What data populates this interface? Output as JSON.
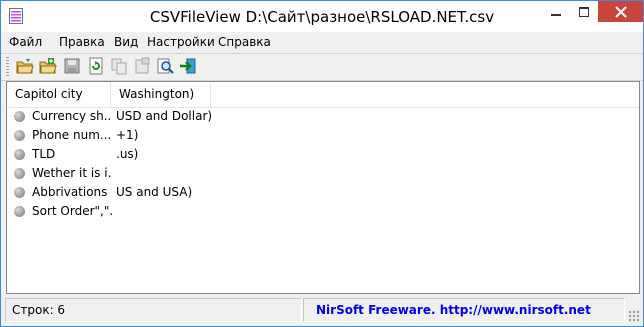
{
  "window": {
    "app_name": "CSVFileView",
    "file_path": "D:\\Сайт\\разное\\RSLOAD.NET.csv",
    "title": "CSVFileView   D:\\Сайт\\разное\\RSLOAD.NET.csv"
  },
  "menu": {
    "items": [
      {
        "label": "Файл"
      },
      {
        "label": "Правка"
      },
      {
        "label": "Вид"
      },
      {
        "label": "Настройки"
      },
      {
        "label": "Справка"
      }
    ]
  },
  "toolbar": {
    "buttons": [
      {
        "icon": "open-folder-icon"
      },
      {
        "icon": "open-folder-green-icon"
      },
      {
        "icon": "save-disk-icon"
      },
      {
        "icon": "refresh-icon"
      },
      {
        "icon": "copy-icon"
      },
      {
        "icon": "properties-icon"
      },
      {
        "icon": "find-icon"
      },
      {
        "icon": "exit-icon"
      }
    ]
  },
  "table": {
    "columns": [
      "Capitol city",
      "Washington)"
    ],
    "rows": [
      {
        "c1": "Currency sh...",
        "c2": "USD and Dollar)"
      },
      {
        "c1": "Phone num...",
        "c2": "+1)"
      },
      {
        "c1": "TLD",
        "c2": ".us)"
      },
      {
        "c1": "Wether it is i...",
        "c2": ""
      },
      {
        "c1": "Abbrivations",
        "c2": "US and USA)"
      },
      {
        "c1": "Sort Order\",\"...",
        "c2": ""
      }
    ]
  },
  "status": {
    "rows_label": "Строк: 6",
    "link_text": "NirSoft Freeware.  http://www.nirsoft.net"
  },
  "colors": {
    "accent_border": "#3c8bdc",
    "close_button": "#c7453b",
    "link": "#0000ee"
  }
}
